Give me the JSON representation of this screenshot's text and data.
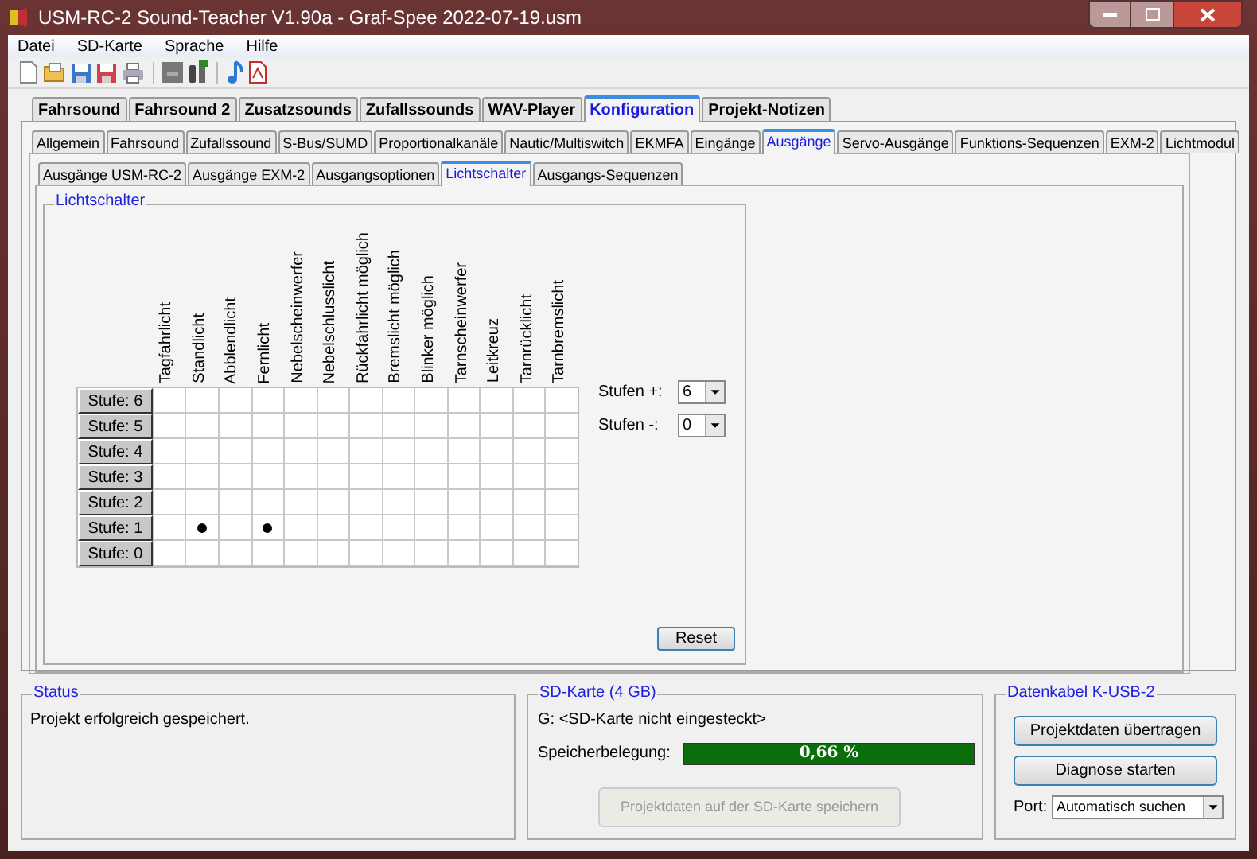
{
  "window": {
    "title": "USM-RC-2 Sound-Teacher V1.90a - Graf-Spee 2022-07-19.usm"
  },
  "menu": [
    "Datei",
    "SD-Karte",
    "Sprache",
    "Hilfe"
  ],
  "main_tabs": [
    {
      "label": "Fahrsound",
      "selected": false
    },
    {
      "label": "Fahrsound 2",
      "selected": false
    },
    {
      "label": "Zusatzsounds",
      "selected": false
    },
    {
      "label": "Zufallssounds",
      "selected": false
    },
    {
      "label": "WAV-Player",
      "selected": false
    },
    {
      "label": "Konfiguration",
      "selected": true
    },
    {
      "label": "Projekt-Notizen",
      "selected": false
    }
  ],
  "sub_tabs": [
    {
      "label": "Allgemein",
      "selected": false
    },
    {
      "label": "Fahrsound",
      "selected": false
    },
    {
      "label": "Zufallssound",
      "selected": false
    },
    {
      "label": "S-Bus/SUMD",
      "selected": false
    },
    {
      "label": "Proportionalkanäle",
      "selected": false
    },
    {
      "label": "Nautic/Multiswitch",
      "selected": false
    },
    {
      "label": "EKMFA",
      "selected": false
    },
    {
      "label": "Eingänge",
      "selected": false
    },
    {
      "label": "Ausgänge",
      "selected": true
    },
    {
      "label": "Servo-Ausgänge",
      "selected": false
    },
    {
      "label": "Funktions-Sequenzen",
      "selected": false
    },
    {
      "label": "EXM-2",
      "selected": false
    },
    {
      "label": "Lichtmodul",
      "selected": false
    }
  ],
  "output_tabs": [
    {
      "label": "Ausgänge USM-RC-2",
      "selected": false
    },
    {
      "label": "Ausgänge EXM-2",
      "selected": false
    },
    {
      "label": "Ausgangsoptionen",
      "selected": false
    },
    {
      "label": "Lichtschalter",
      "selected": true
    },
    {
      "label": "Ausgangs-Sequenzen",
      "selected": false
    }
  ],
  "light_switch": {
    "title": "Lichtschalter",
    "columns": [
      "Tagfahrlicht",
      "Standlicht",
      "Abblendlicht",
      "Fernlicht",
      "Nebelscheinwerfer",
      "Nebelschlusslicht",
      "Rückfahrlicht möglich",
      "Bremslicht möglich",
      "Blinker möglich",
      "Tarnscheinwerfer",
      "Leitkreuz",
      "Tarnrücklicht",
      "Tarnbremslicht"
    ],
    "rows": [
      {
        "label": "Stufe: 6",
        "cells": [
          false,
          false,
          false,
          false,
          false,
          false,
          false,
          false,
          false,
          false,
          false,
          false,
          false
        ]
      },
      {
        "label": "Stufe: 5",
        "cells": [
          false,
          false,
          false,
          false,
          false,
          false,
          false,
          false,
          false,
          false,
          false,
          false,
          false
        ]
      },
      {
        "label": "Stufe: 4",
        "cells": [
          false,
          false,
          false,
          false,
          false,
          false,
          false,
          false,
          false,
          false,
          false,
          false,
          false
        ]
      },
      {
        "label": "Stufe: 3",
        "cells": [
          false,
          false,
          false,
          false,
          false,
          false,
          false,
          false,
          false,
          false,
          false,
          false,
          false
        ]
      },
      {
        "label": "Stufe: 2",
        "cells": [
          false,
          false,
          false,
          false,
          false,
          false,
          false,
          false,
          false,
          false,
          false,
          false,
          false
        ]
      },
      {
        "label": "Stufe: 1",
        "cells": [
          false,
          true,
          false,
          true,
          false,
          false,
          false,
          false,
          false,
          false,
          false,
          false,
          false
        ]
      },
      {
        "label": "Stufe: 0",
        "cells": [
          false,
          false,
          false,
          false,
          false,
          false,
          false,
          false,
          false,
          false,
          false,
          false,
          false
        ]
      }
    ],
    "steps": [
      {
        "label": "Stufen +:",
        "value": "6"
      },
      {
        "label": "Stufen -:",
        "value": "0"
      }
    ],
    "reset": "Reset"
  },
  "status": {
    "title": "Status",
    "message": "Projekt erfolgreich gespeichert."
  },
  "sd_card": {
    "title": "SD-Karte (4 GB)",
    "drive": "G: <SD-Karte nicht eingesteckt>",
    "usage_label": "Speicherbelegung:",
    "usage": "0,66 %",
    "save_button": {
      "label": "Projektdaten auf der SD-Karte speichern",
      "disabled": true
    }
  },
  "cable": {
    "title": "Datenkabel K-USB-2",
    "buttons": [
      "Projektdaten übertragen",
      "Diagnose starten"
    ],
    "port_label": "Port:",
    "port_value": "Automatisch suchen"
  }
}
